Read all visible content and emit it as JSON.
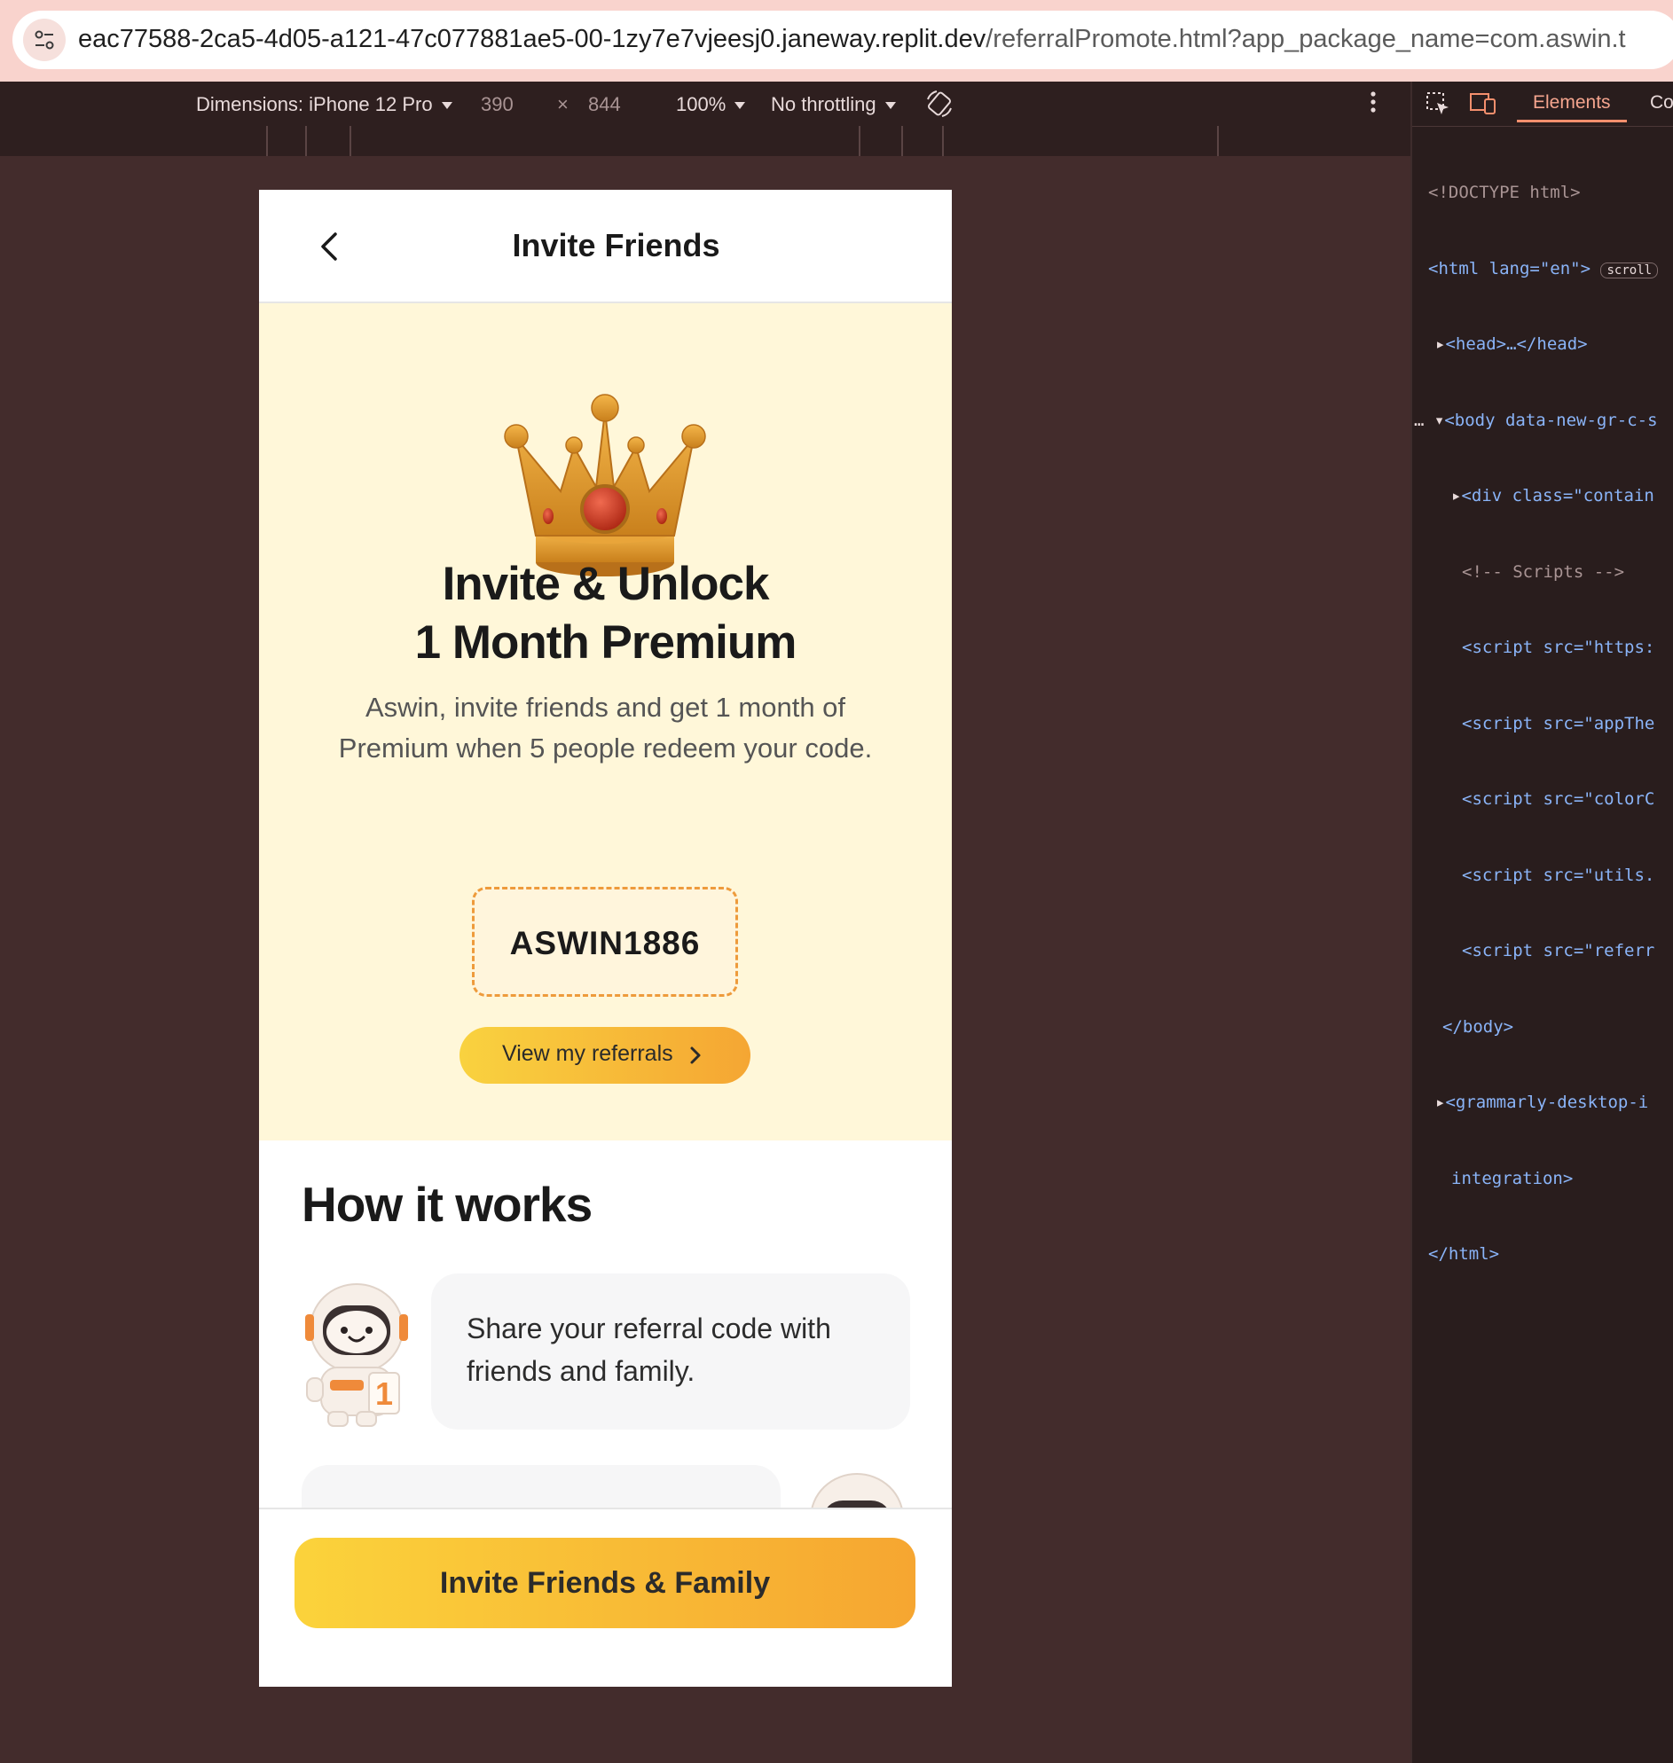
{
  "browser": {
    "url_host": "eac77588-2ca5-4d05-a121-47c077881ae5-00-1zy7e7vjeesj0.janeway.replit.dev",
    "url_path": "/referralPromote.html?app_package_name=com.aswin.t"
  },
  "device_toolbar": {
    "dimensions_label": "Dimensions: iPhone 12 Pro",
    "width": "390",
    "times": "×",
    "height": "844",
    "zoom": "100%",
    "throttling": "No throttling",
    "more_icon": "more-vert-icon"
  },
  "devtools": {
    "tab_elements": "Elements",
    "tab_console": "Co",
    "lines": [
      "<!DOCTYPE html>",
      "<html lang=\"en\">",
      "<head>…</head>",
      "<body data-new-gr-c-s",
      "<div class=\"contain",
      "<!-- Scripts -->",
      "<script src=\"https:",
      "<script src=\"appThe",
      "<script src=\"colorC",
      "<script src=\"utils.",
      "<script src=\"referr",
      "</body>",
      "<grammarly-desktop-i",
      "integration>",
      "</html>"
    ],
    "scroll_badge": "scroll"
  },
  "app": {
    "header_title": "Invite Friends",
    "hero": {
      "title_line1": "Invite & Unlock",
      "title_line2": "1 Month Premium",
      "subtitle_line1": "Aswin, invite friends and get 1 month of",
      "subtitle_line2": "Premium when 5 people redeem your code.",
      "referral_code": "ASWIN1886",
      "view_referrals_label": "View my referrals"
    },
    "how_it_works": {
      "title": "How it works",
      "steps": [
        {
          "text": "Share your referral code with friends and family."
        }
      ]
    },
    "cta_label": "Invite Friends & Family"
  },
  "colors": {
    "hero_bg": "#fff7d9",
    "accent_start": "#f9d23f",
    "accent_end": "#f5a633",
    "code_border": "#ee9b3c"
  }
}
